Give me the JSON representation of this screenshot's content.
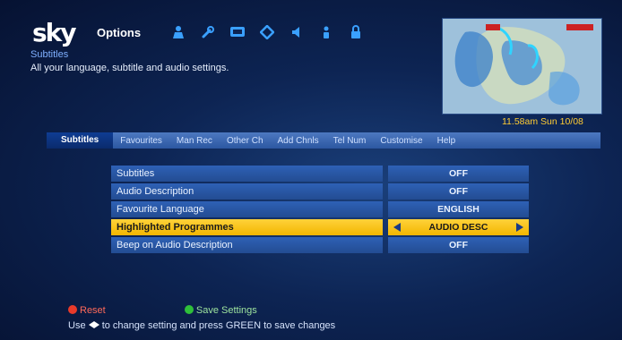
{
  "header": {
    "logo": "sky",
    "menu_title": "Options",
    "breadcrumb": "Subtitles",
    "description": "All your language, subtitle and audio settings."
  },
  "clock": "11.58am Sun 10/08",
  "tabs": [
    {
      "label": "Subtitles",
      "active": true
    },
    {
      "label": "Favourites",
      "active": false
    },
    {
      "label": "Man Rec",
      "active": false
    },
    {
      "label": "Other Ch",
      "active": false
    },
    {
      "label": "Add Chnls",
      "active": false
    },
    {
      "label": "Tel Num",
      "active": false
    },
    {
      "label": "Customise",
      "active": false
    },
    {
      "label": "Help",
      "active": false
    }
  ],
  "settings": [
    {
      "label": "Subtitles",
      "value": "OFF"
    },
    {
      "label": "Audio Description",
      "value": "OFF"
    },
    {
      "label": "Favourite Language",
      "value": "ENGLISH"
    },
    {
      "label": "Highlighted Programmes",
      "value": "AUDIO DESC",
      "highlighted": true
    },
    {
      "label": "Beep on Audio Description",
      "value": "OFF"
    }
  ],
  "footer": {
    "reset_label": "Reset",
    "save_label": "Save Settings",
    "hint_prefix": "Use",
    "hint_suffix": "to change setting and press GREEN to save changes"
  },
  "icons": [
    "person-icon",
    "wrench-icon",
    "tv-icon",
    "tag-icon",
    "speaker-icon",
    "user-icon",
    "lock-icon"
  ],
  "colors": {
    "accent_yellow": "#ffcc33",
    "tab_bar": "#4d79c1",
    "row_bg": "#2e61b6",
    "highlight": "#ffd23a",
    "red_button": "#e83a2a",
    "green_button": "#2fbf3a"
  }
}
